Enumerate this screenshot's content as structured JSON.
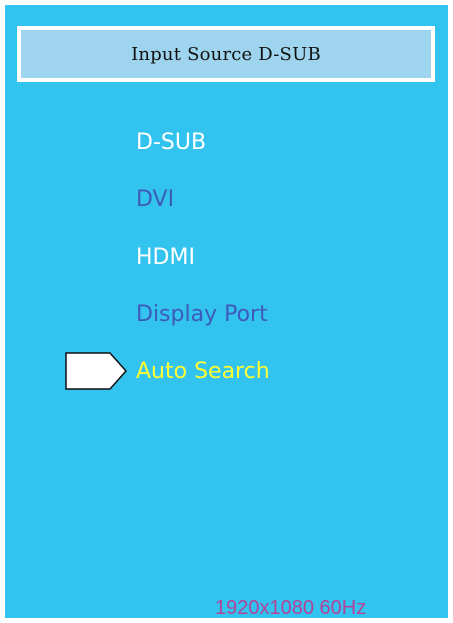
{
  "osd": {
    "title": "Input Source D-SUB",
    "menu_items": [
      {
        "label": "D-SUB",
        "color": "#ffffff",
        "selected": false
      },
      {
        "label": "DVI",
        "color": "#3d5bb8",
        "selected": false
      },
      {
        "label": "HDMI",
        "color": "#ffffff",
        "selected": false
      },
      {
        "label": "Display Port",
        "color": "#3d5bb8",
        "selected": false
      },
      {
        "label": "Auto Search",
        "color": "#ffff33",
        "selected": true
      }
    ],
    "cursor_icon": "pointer-arrow-icon",
    "resolution": "1920x1080 60Hz",
    "colors": {
      "panel_background": "#33c3ef",
      "title_background": "#9ed4ee",
      "title_border": "#ffffff",
      "active_item": "#ffff33",
      "inactive_item": "#3d5bb8",
      "available_item": "#ffffff",
      "resolution_text": "#b2449a"
    }
  }
}
